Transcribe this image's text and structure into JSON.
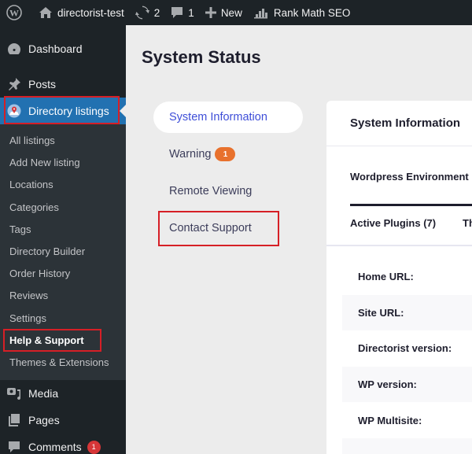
{
  "adminbar": {
    "site_name": "directorist-test",
    "updates_count": "2",
    "comments_count": "1",
    "new_label": "New",
    "rankmath_label": "Rank Math SEO"
  },
  "sidebar": {
    "top_items": [
      {
        "label": "Dashboard",
        "icon": "dashboard-icon"
      },
      {
        "label": "Posts",
        "icon": "pin-icon"
      },
      {
        "label": "Directory listings",
        "icon": "map-pin-icon"
      }
    ],
    "submenu": [
      "All listings",
      "Add New listing",
      "Locations",
      "Categories",
      "Tags",
      "Directory Builder",
      "Order History",
      "Reviews",
      "Settings",
      "Help & Support",
      "Themes & Extensions"
    ],
    "bottom_items": [
      {
        "label": "Media",
        "icon": "media-icon"
      },
      {
        "label": "Pages",
        "icon": "pages-icon"
      },
      {
        "label": "Comments",
        "icon": "comment-icon",
        "badge": "1"
      }
    ]
  },
  "main": {
    "title": "System Status",
    "nav": [
      {
        "label": "System Information",
        "active": true
      },
      {
        "label": "Warning",
        "badge": "1"
      },
      {
        "label": "Remote Viewing"
      },
      {
        "label": "Contact Support"
      }
    ],
    "panel": {
      "title": "System Information",
      "tabs": [
        "Wordpress Environment",
        "Active Plugins (7)",
        "Th"
      ],
      "rows": [
        "Home URL:",
        "Site URL:",
        "Directorist version:",
        "WP version:",
        "WP Multisite:"
      ]
    }
  },
  "colors": {
    "admin_dark": "#1d2327",
    "wp_blue": "#2271b1",
    "accent_blue": "#3e4ed8",
    "warning_orange": "#e8712d",
    "highlight_red": "#d61f26"
  }
}
